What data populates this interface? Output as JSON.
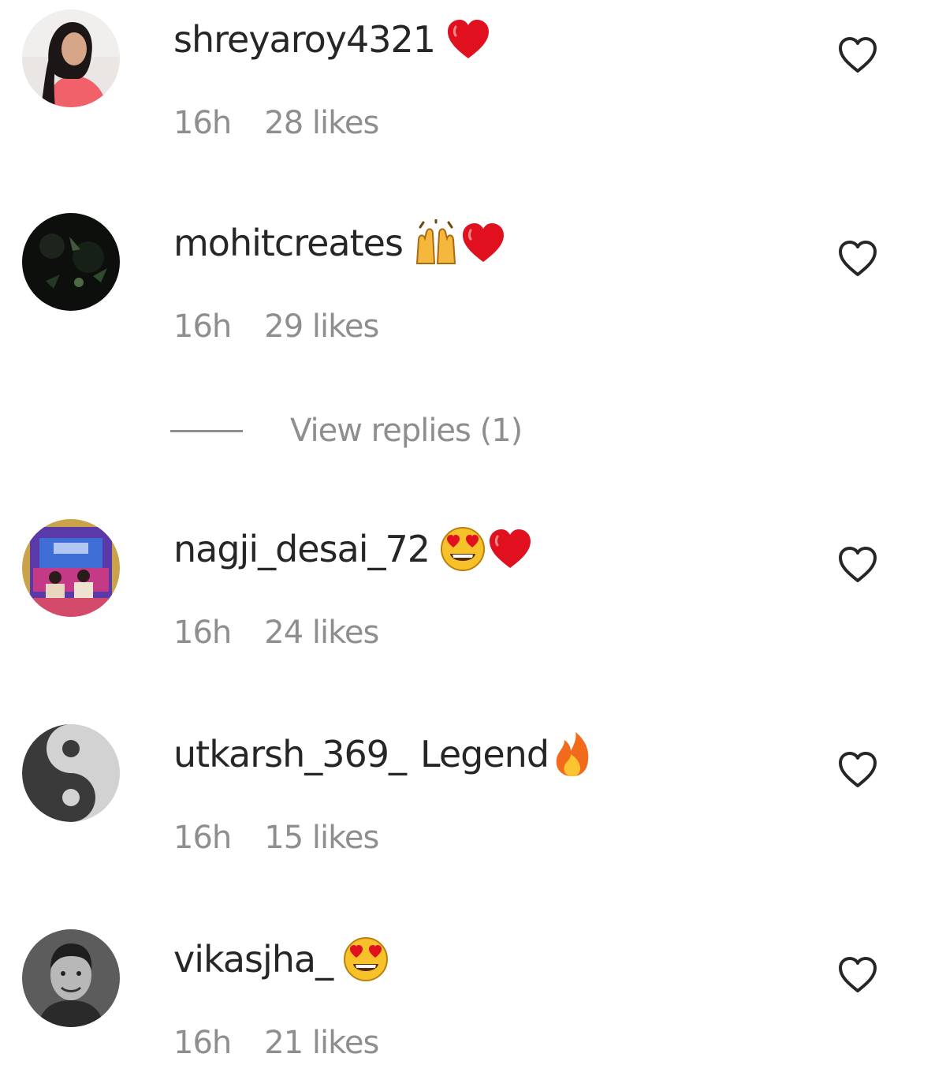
{
  "comments": [
    {
      "username": "shreyaroy4321",
      "text": "",
      "emojis": [
        "red-heart"
      ],
      "time": "16h",
      "likes": "28 likes",
      "avatar": "woman-pink-top-avatar"
    },
    {
      "username": "mohitcreates",
      "text": "",
      "emojis": [
        "raising-hands",
        "red-heart"
      ],
      "time": "16h",
      "likes": "29 likes",
      "avatar": "dark-foliage-avatar",
      "view_replies": "View replies (1)"
    },
    {
      "username": "nagji_desai_72",
      "text": "",
      "emojis": [
        "heart-eyes-face",
        "red-heart"
      ],
      "time": "16h",
      "likes": "24 likes",
      "avatar": "colorful-group-avatar"
    },
    {
      "username": "utkarsh_369_",
      "text": "Legend",
      "emojis": [
        "fire"
      ],
      "time": "16h",
      "likes": "15 likes",
      "avatar": "yin-yang-avatar"
    },
    {
      "username": "vikasjha_",
      "text": "",
      "emojis": [
        "heart-eyes-face"
      ],
      "time": "16h",
      "likes": "21 likes",
      "avatar": "man-portrait-avatar"
    }
  ],
  "colors": {
    "text": "#262626",
    "meta": "#8e8e8e",
    "heart_red": "#e0101e"
  }
}
